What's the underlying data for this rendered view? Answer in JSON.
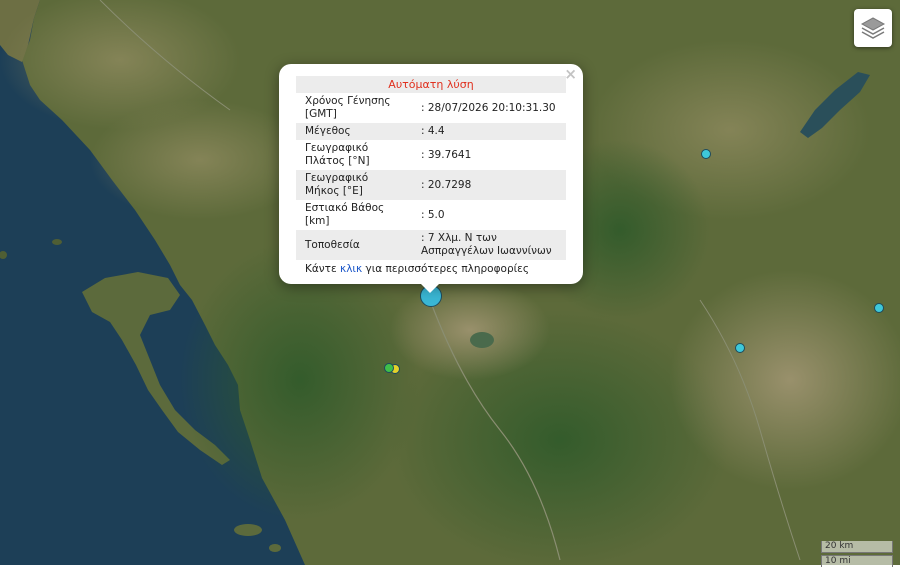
{
  "popup": {
    "title": "Αυτόματη λύση",
    "rows": [
      {
        "label": "Χρόνος Γένησης [GMT]",
        "value": ": 28/07/2026 20:10:31.30"
      },
      {
        "label": "Μέγεθος",
        "value": ": 4.4"
      },
      {
        "label": "Γεωγραφικό Πλάτος [°N]",
        "value": ": 39.7641"
      },
      {
        "label": "Γεωγραφικό Μήκος [°E]",
        "value": ": 20.7298"
      },
      {
        "label": "Εστιακό Βάθος [km]",
        "value": ": 5.0"
      },
      {
        "label": "Τοποθεσία",
        "value": ": 7 Χλμ. Ν των Ασπραγγέλων Ιωαννίνων"
      }
    ],
    "more_prefix": "Κάντε ",
    "more_link": "κλικ",
    "more_suffix": " για περισσότερες πληροφορίες",
    "close": "×"
  },
  "scale": {
    "km": "20 km",
    "mi": "10 mi"
  },
  "colors": {
    "sea": "#1d3f57",
    "event_selected": "#3ab7d4",
    "event_cyan": "#3ec8d9",
    "event_green": "#3fbf4a",
    "event_yellow": "#e4d22a",
    "popup_title": "#e0301e",
    "link": "#1a56c9"
  },
  "icons": {
    "layers": "layers-icon",
    "close": "close-icon"
  }
}
